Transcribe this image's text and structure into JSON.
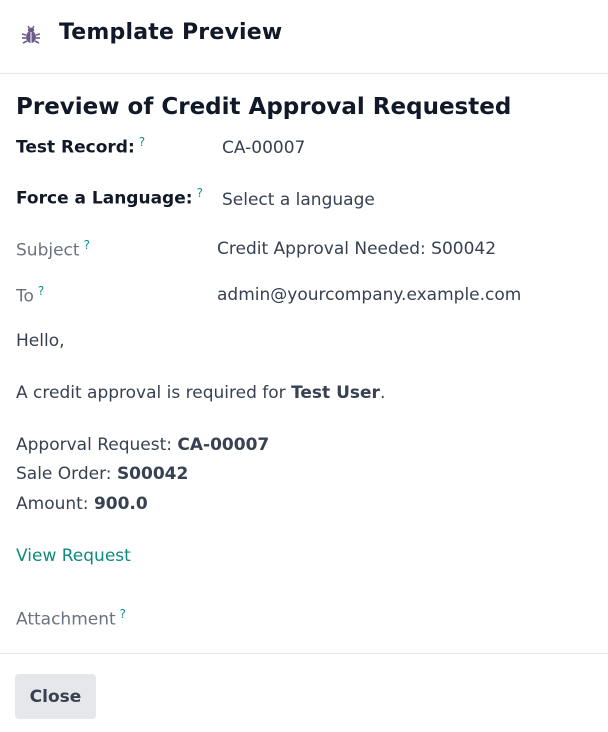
{
  "header": {
    "title": "Template Preview",
    "icon": "bug-icon"
  },
  "preview": {
    "title": "Preview of Credit Approval Requested",
    "test_record": {
      "label": "Test Record:",
      "help": "?",
      "value": "CA-00007"
    },
    "force_language": {
      "label": "Force a Language:",
      "help": "?",
      "placeholder": "Select a language"
    },
    "subject": {
      "label": "Subject",
      "help": "?",
      "value": "Credit Approval Needed: S00042"
    },
    "to": {
      "label": "To",
      "help": "?",
      "value": "admin@yourcompany.example.com"
    }
  },
  "email_body": {
    "greeting": "Hello,",
    "line_prefix": "A credit approval is required for ",
    "line_user": "Test User",
    "line_suffix": ".",
    "request_label": "Apporval Request: ",
    "request_value": "CA-00007",
    "order_label": "Sale Order: ",
    "order_value": "S00042",
    "amount_label": "Amount: ",
    "amount_value": "900.0",
    "view_link": "View Request"
  },
  "attachment": {
    "label": "Attachment",
    "help": "?"
  },
  "footer": {
    "close_label": "Close"
  },
  "colors": {
    "accent": "#0f8a7e",
    "button_bg": "#e5e7eb",
    "icon": "#6b5b8c"
  }
}
